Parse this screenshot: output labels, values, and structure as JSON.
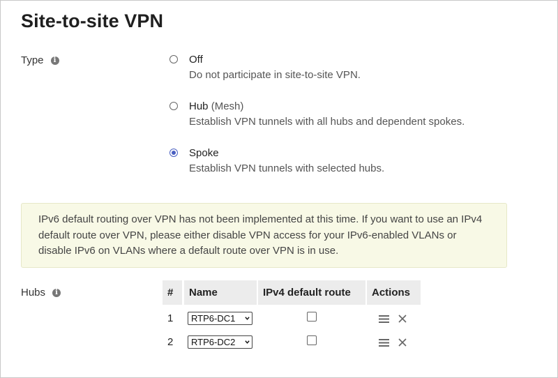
{
  "page": {
    "title": "Site-to-site VPN"
  },
  "type_field": {
    "label": "Type",
    "options": [
      {
        "title": "Off",
        "title_suffix": "",
        "description": "Do not participate in site-to-site VPN.",
        "selected": false
      },
      {
        "title": "Hub",
        "title_suffix": "(Mesh)",
        "description": "Establish VPN tunnels with all hubs and dependent spokes.",
        "selected": false
      },
      {
        "title": "Spoke",
        "title_suffix": "",
        "description": "Establish VPN tunnels with selected hubs.",
        "selected": true
      }
    ]
  },
  "alert": {
    "text": "IPv6 default routing over VPN has not been implemented at this time. If you want to use an IPv4 default route over VPN, please either disable VPN access for your IPv6-enabled VLANs or disable IPv6 on VLANs where a default route over VPN is in use."
  },
  "hubs": {
    "label": "Hubs",
    "columns": [
      "#",
      "Name",
      "IPv4 default route",
      "Actions"
    ],
    "rows": [
      {
        "num": "1",
        "name": "RTP6-DC1",
        "ipv4_default_route": false
      },
      {
        "num": "2",
        "name": "RTP6-DC2",
        "ipv4_default_route": false
      }
    ]
  },
  "colors": {
    "accent": "#4a5fc1",
    "alert_bg": "#f8f9e6",
    "header_bg": "#ececec"
  }
}
